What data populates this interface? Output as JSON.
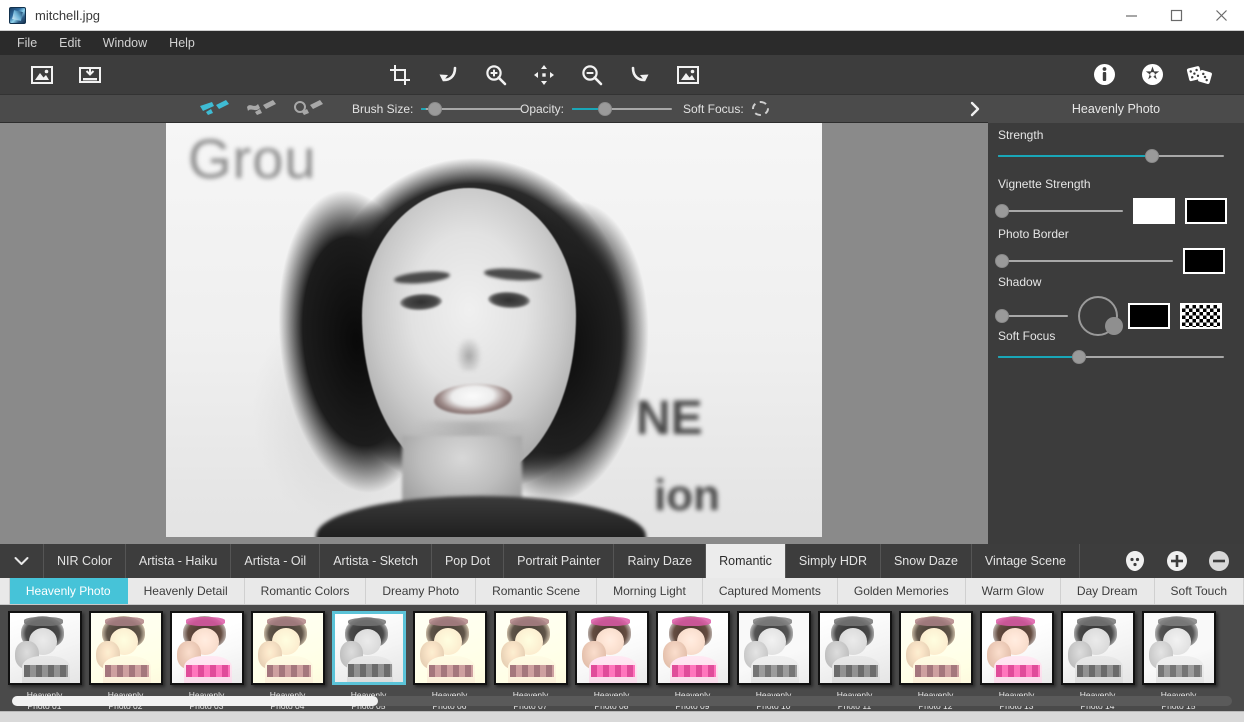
{
  "window": {
    "title": "mitchell.jpg",
    "app_icon": "app-icon",
    "minimize": "minimize-icon",
    "maximize": "maximize-icon",
    "close": "close-icon"
  },
  "menu": {
    "items": [
      {
        "label": "File"
      },
      {
        "label": "Edit"
      },
      {
        "label": "Window"
      },
      {
        "label": "Help"
      }
    ]
  },
  "toolbar": {
    "left": [
      {
        "name": "open-image-icon"
      },
      {
        "name": "save-image-icon"
      }
    ],
    "center": [
      {
        "name": "crop-icon"
      },
      {
        "name": "undo-icon"
      },
      {
        "name": "zoom-in-icon"
      },
      {
        "name": "pan-move-icon"
      },
      {
        "name": "zoom-out-icon"
      },
      {
        "name": "redo-icon"
      },
      {
        "name": "fit-image-icon"
      }
    ],
    "right": [
      {
        "name": "info-icon"
      },
      {
        "name": "settings-icon"
      },
      {
        "name": "random-dice-icon"
      }
    ]
  },
  "options": {
    "brush_modes": [
      {
        "name": "brush-paint-icon",
        "active": true
      },
      {
        "name": "brush-erase-icon",
        "active": false
      },
      {
        "name": "brush-reset-icon",
        "active": false
      }
    ],
    "brush_size": {
      "label": "Brush Size:",
      "value": 17,
      "fill_pct": 4
    },
    "opacity": {
      "label": "Opacity:",
      "value": 50,
      "fill_pct": 28
    },
    "soft_focus": {
      "label": "Soft Focus:",
      "icon": "soft-focus-ring-icon"
    },
    "expand": "chevron-right-icon"
  },
  "panel": {
    "title": "Heavenly Photo",
    "controls": [
      {
        "label": "Strength",
        "slider_pct": 68,
        "fill": true
      },
      {
        "label": "Vignette Strength",
        "slider_pct": 0,
        "fill": false,
        "swatches": [
          "white",
          "black"
        ]
      },
      {
        "label": "Photo Border",
        "slider_pct": 0,
        "fill": false,
        "swatches": [
          "black"
        ]
      },
      {
        "label": "Shadow",
        "slider_pct": 0,
        "fill": false,
        "dial": true,
        "swatches": [
          "black",
          "checker"
        ]
      },
      {
        "label": "Soft Focus",
        "slider_pct": 36,
        "fill": true
      }
    ]
  },
  "canvas": {
    "image_name": "mitchell.jpg",
    "background_text": [
      "Grou",
      "NE",
      "ion"
    ]
  },
  "tabs": {
    "collapse_icon": "chevron-down-icon",
    "items": [
      {
        "label": "NIR Color",
        "active": false
      },
      {
        "label": "Artista - Haiku",
        "active": false
      },
      {
        "label": "Artista - Oil",
        "active": false
      },
      {
        "label": "Artista - Sketch",
        "active": false
      },
      {
        "label": "Pop Dot",
        "active": false
      },
      {
        "label": "Portrait Painter",
        "active": false
      },
      {
        "label": "Rainy Daze",
        "active": false
      },
      {
        "label": "Romantic",
        "active": true
      },
      {
        "label": "Simply HDR",
        "active": false
      },
      {
        "label": "Snow Daze",
        "active": false
      },
      {
        "label": "Vintage Scene",
        "active": false
      }
    ],
    "actions": [
      {
        "name": "face-detect-icon"
      },
      {
        "name": "add-icon"
      },
      {
        "name": "remove-icon"
      }
    ]
  },
  "subtabs": {
    "items": [
      {
        "label": "Heavenly Photo",
        "active": true
      },
      {
        "label": "Heavenly Detail",
        "active": false
      },
      {
        "label": "Romantic Colors",
        "active": false
      },
      {
        "label": "Dreamy Photo",
        "active": false
      },
      {
        "label": "Romantic Scene",
        "active": false
      },
      {
        "label": "Morning Light",
        "active": false
      },
      {
        "label": "Captured Moments",
        "active": false
      },
      {
        "label": "Golden Memories",
        "active": false
      },
      {
        "label": "Warm Glow",
        "active": false
      },
      {
        "label": "Day Dream",
        "active": false
      },
      {
        "label": "Soft Touch",
        "active": false
      }
    ]
  },
  "filmstrip": {
    "scroll_pct": 30,
    "thumbnails": [
      {
        "caption": "Heavenly\nPhoto 01",
        "style": "gray",
        "selected": false
      },
      {
        "caption": "Heavenly\nPhoto 02",
        "style": "sepia",
        "selected": false
      },
      {
        "caption": "Heavenly\nPhoto 03",
        "style": "soft",
        "selected": false
      },
      {
        "caption": "Heavenly\nPhoto 04",
        "style": "sepia",
        "selected": false
      },
      {
        "caption": "Heavenly\nPhoto 05",
        "style": "gray",
        "selected": true
      },
      {
        "caption": "Heavenly\nPhoto 06",
        "style": "sepia",
        "selected": false
      },
      {
        "caption": "Heavenly\nPhoto 07",
        "style": "sepia",
        "selected": false
      },
      {
        "caption": "Heavenly\nPhoto 08",
        "style": "soft",
        "selected": false
      },
      {
        "caption": "Heavenly\nPhoto 09",
        "style": "soft",
        "selected": false
      },
      {
        "caption": "Heavenly\nPhoto 10",
        "style": "mono2",
        "selected": false
      },
      {
        "caption": "Heavenly\nPhoto 11",
        "style": "gray",
        "selected": false
      },
      {
        "caption": "Heavenly\nPhoto 12",
        "style": "sepia",
        "selected": false
      },
      {
        "caption": "Heavenly\nPhoto 13",
        "style": "soft",
        "selected": false
      },
      {
        "caption": "Heavenly\nPhoto 14",
        "style": "gray",
        "selected": false
      },
      {
        "caption": "Heavenly\nPhoto 15",
        "style": "mono2",
        "selected": false
      }
    ]
  },
  "colors": {
    "accent": "#19a7b8",
    "subtab_active": "#46c3d8",
    "selection_border": "#5bc3d8",
    "toolbar_bg": "#3d3d3d",
    "panel_bg": "#3c3c3c",
    "options_bg": "#4b4b4b"
  }
}
